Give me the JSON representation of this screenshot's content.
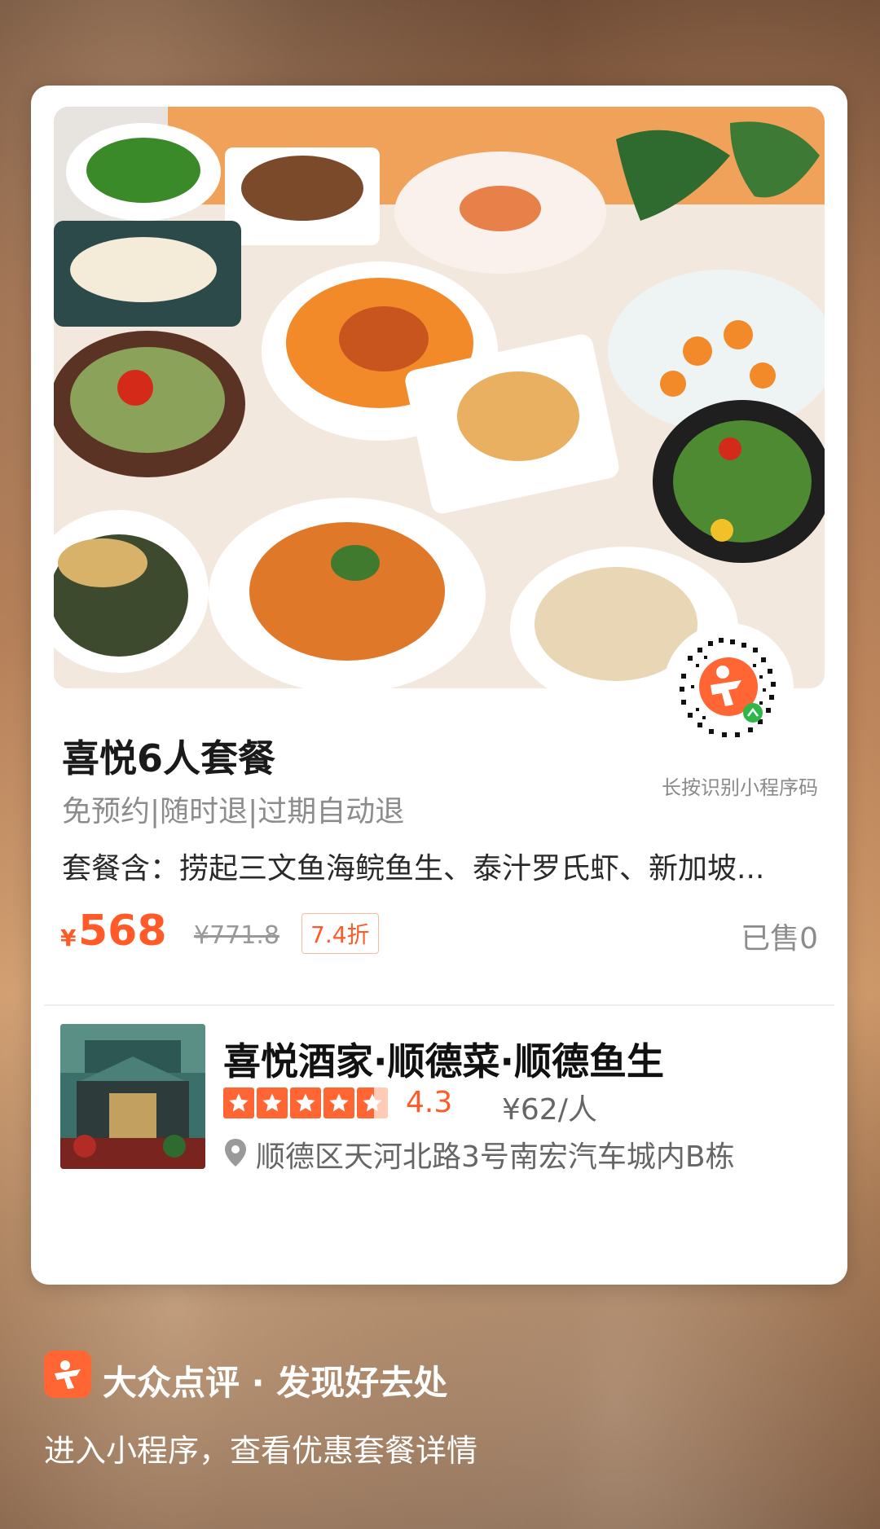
{
  "deal": {
    "title": "喜悦6人套餐",
    "tags": "免预约|随时退|过期自动退",
    "includes": "套餐含：捞起三文鱼海鲩鱼生、泰汁罗氏虾、新加坡...",
    "currency": "¥",
    "price": "568",
    "original_price": "¥771.8",
    "discount": "7.4折",
    "sold": "已售0",
    "qr_hint": "长按识别小程序码"
  },
  "shop": {
    "name": "喜悦酒家·顺德菜·顺德鱼生",
    "rating_stars": 4.5,
    "score": "4.3",
    "avg_price": "¥62/人",
    "address": "顺德区天河北路3号南宏汽车城内B栋"
  },
  "footer": {
    "brand": "大众点评 · 发现好去处",
    "subtitle": "进入小程序，查看优惠套餐详情"
  },
  "colors": {
    "accent": "#ff5a27",
    "star": "#ff6633"
  },
  "icons": {
    "logo": "dianping-logo-icon",
    "location": "location-pin-icon",
    "qr": "mini-program-qr-icon"
  }
}
